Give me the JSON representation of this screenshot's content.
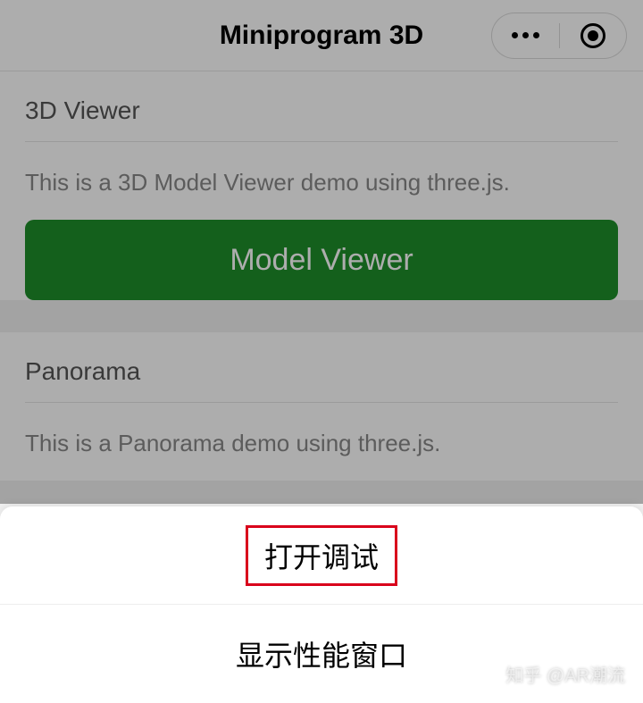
{
  "navbar": {
    "title": "Miniprogram 3D",
    "menu_icon": "more-icon",
    "close_icon": "target-icon"
  },
  "sections": [
    {
      "title": "3D Viewer",
      "description": "This is a 3D Model Viewer demo using three.js.",
      "button_label": "Model Viewer"
    },
    {
      "title": "Panorama",
      "description": "This is a Panorama demo using three.js."
    }
  ],
  "action_sheet": {
    "items": [
      {
        "label": "打开调试",
        "highlighted": true
      },
      {
        "label": "显示性能窗口",
        "highlighted": false
      }
    ]
  },
  "watermark": "知乎 @AR潮流"
}
